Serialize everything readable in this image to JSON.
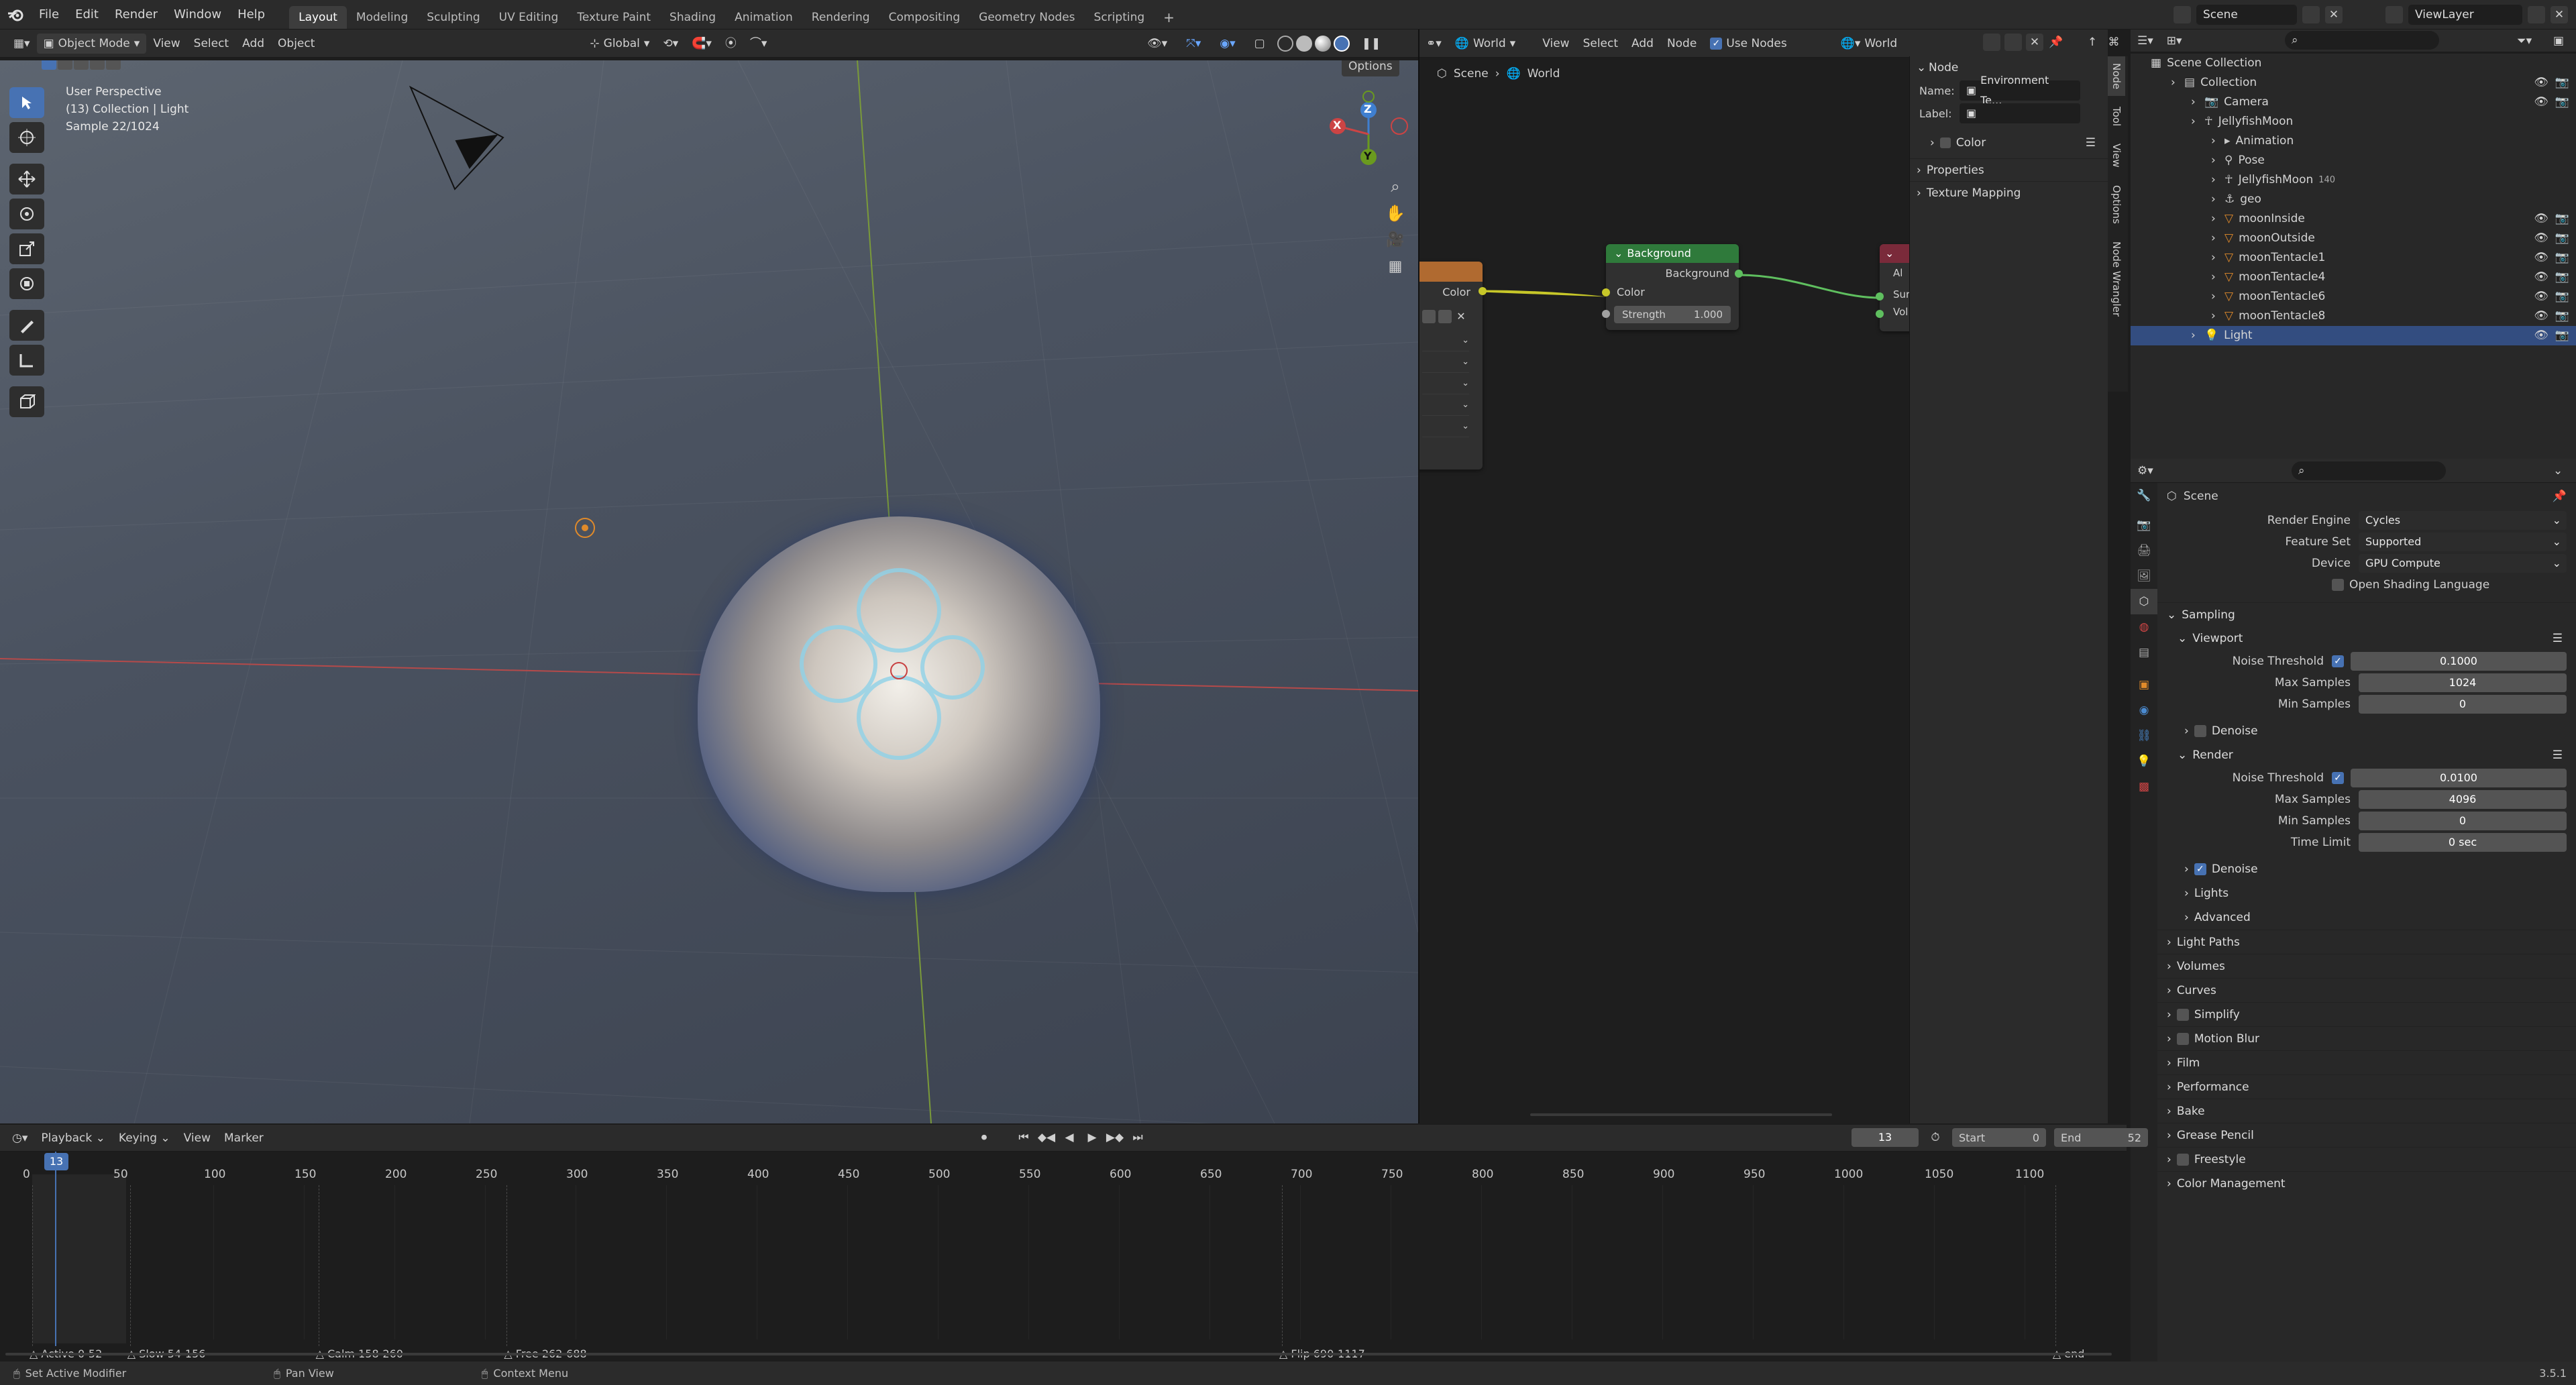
{
  "topbar": {
    "menus": [
      "File",
      "Edit",
      "Render",
      "Window",
      "Help"
    ],
    "workspaces": [
      "Layout",
      "Modeling",
      "Sculpting",
      "UV Editing",
      "Texture Paint",
      "Shading",
      "Animation",
      "Rendering",
      "Compositing",
      "Geometry Nodes",
      "Scripting"
    ],
    "active_workspace": "Layout",
    "scene": "Scene",
    "view_layer": "ViewLayer"
  },
  "viewport": {
    "mode": "Object Mode",
    "menus": [
      "View",
      "Select",
      "Add",
      "Object"
    ],
    "transform": "Global",
    "options_label": "Options",
    "info_line1": "User Perspective",
    "info_line2": "(13) Collection | Light",
    "info_line3": "Sample 22/1024",
    "gizmo": {
      "x": "X",
      "y": "Y",
      "z": "Z"
    }
  },
  "node_editor": {
    "world_label": "World",
    "menus": [
      "View",
      "Select",
      "Add",
      "Node"
    ],
    "use_nodes_label": "Use Nodes",
    "world_name": "World",
    "breadcrumb": [
      "Scene",
      "World"
    ],
    "background_node": {
      "title": "Background",
      "output": "Background",
      "input_color": "Color",
      "strength_label": "Strength",
      "strength_value": "1.000"
    },
    "env_node_color": "Color",
    "output_node_sockets": [
      "Al",
      "Sur",
      "Vol"
    ],
    "npanel": {
      "section": "Node",
      "name_label": "Name:",
      "name_value": "Environment Te...",
      "label_label": "Label:",
      "color": "Color",
      "properties": "Properties",
      "texture_mapping": "Texture Mapping"
    },
    "side_tabs": [
      "Node",
      "Tool",
      "View",
      "Options",
      "Node Wrangler"
    ]
  },
  "outliner": {
    "root": "Scene Collection",
    "items": [
      {
        "label": "Collection",
        "indent": 1
      },
      {
        "label": "Camera",
        "indent": 2
      },
      {
        "label": "JellyfishMoon",
        "indent": 2
      },
      {
        "label": "Animation",
        "indent": 3
      },
      {
        "label": "Pose",
        "indent": 3
      },
      {
        "label": "JellyfishMoon",
        "indent": 3,
        "badge": "140"
      },
      {
        "label": "geo",
        "indent": 3
      },
      {
        "label": "moonInside",
        "indent": 3
      },
      {
        "label": "moonOutside",
        "indent": 3
      },
      {
        "label": "moonTentacle1",
        "indent": 3
      },
      {
        "label": "moonTentacle4",
        "indent": 3
      },
      {
        "label": "moonTentacle6",
        "indent": 3
      },
      {
        "label": "moonTentacle8",
        "indent": 3
      },
      {
        "label": "Light",
        "indent": 2
      }
    ],
    "selected": "Light"
  },
  "properties": {
    "context": "Scene",
    "render_engine_label": "Render Engine",
    "render_engine": "Cycles",
    "feature_set_label": "Feature Set",
    "feature_set": "Supported",
    "device_label": "Device",
    "device": "GPU Compute",
    "osl_label": "Open Shading Language",
    "sampling": "Sampling",
    "viewport": "Viewport",
    "vp_noise_label": "Noise Threshold",
    "vp_noise": "0.1000",
    "vp_max_label": "Max Samples",
    "vp_max": "1024",
    "vp_min_label": "Min Samples",
    "vp_min": "0",
    "denoise": "Denoise",
    "render": "Render",
    "r_noise_label": "Noise Threshold",
    "r_noise": "0.0100",
    "r_max_label": "Max Samples",
    "r_max": "4096",
    "r_min_label": "Min Samples",
    "r_min": "0",
    "time_limit_label": "Time Limit",
    "time_limit": "0 sec",
    "denoise2": "Denoise",
    "lights": "Lights",
    "advanced": "Advanced",
    "sections": [
      "Light Paths",
      "Volumes",
      "Curves",
      "Simplify",
      "Motion Blur",
      "Film",
      "Performance",
      "Bake",
      "Grease Pencil",
      "Freestyle",
      "Color Management"
    ]
  },
  "timeline": {
    "menus": [
      "Playback",
      "Keying",
      "View",
      "Marker"
    ],
    "current_frame": "13",
    "start_label": "Start",
    "start": "0",
    "end_label": "End",
    "end": "52",
    "ticks": [
      "0",
      "50",
      "100",
      "150",
      "200",
      "250",
      "300",
      "350",
      "400",
      "450",
      "500",
      "550",
      "600",
      "650",
      "700",
      "750",
      "800",
      "850",
      "900",
      "950",
      "1000",
      "1050",
      "1100"
    ],
    "markers": [
      "Active 0-52",
      "Slow 54-156",
      "Calm 158-260",
      "Free 262-688",
      "Flip 690-1117",
      "end"
    ]
  },
  "statusbar": {
    "left": "Set Active Modifier",
    "middle": "Pan View",
    "right": "Context Menu",
    "version": "3.5.1"
  }
}
